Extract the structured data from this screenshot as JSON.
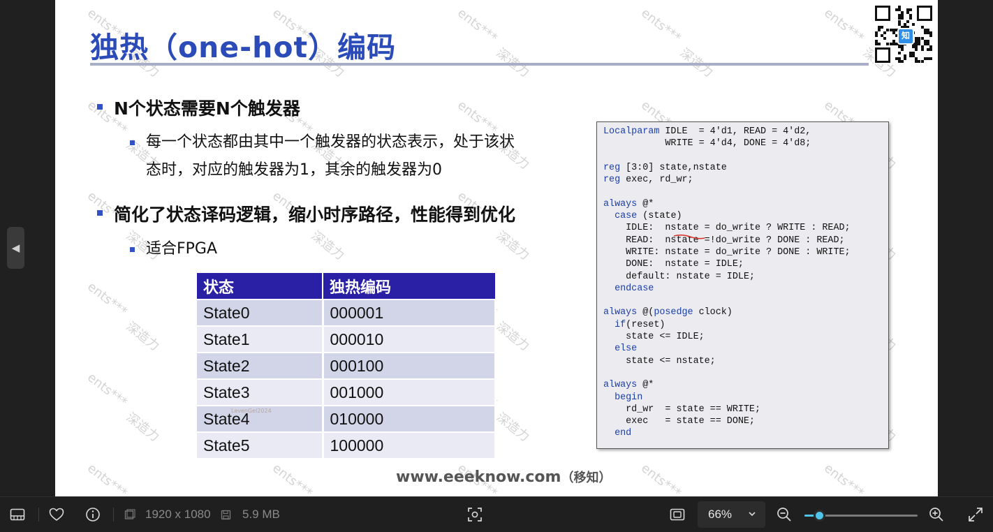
{
  "slide": {
    "title": "独热（one-hot）编码",
    "bullets": [
      {
        "level": 1,
        "text": "N个状态需要N个触发器"
      },
      {
        "level": 2,
        "lines": [
          "每一个状态都由其中一个触发器的状态表示，处于该状",
          "态时，对应的触发器为1，其余的触发器为0"
        ]
      },
      {
        "level": 1,
        "text": "简化了状态译码逻辑，缩小时序路径，性能得到优化"
      },
      {
        "level": 2,
        "lines": [
          "适合FPGA"
        ]
      }
    ],
    "table": {
      "headers": [
        "状态",
        "独热编码"
      ],
      "rows": [
        [
          "State0",
          "000001"
        ],
        [
          "State1",
          "000010"
        ],
        [
          "State2",
          "000100"
        ],
        [
          "State3",
          "001000"
        ],
        [
          "State4",
          "010000"
        ],
        [
          "State5",
          "100000"
        ]
      ]
    },
    "code_lines": [
      "Localparam IDLE  = 4'd1, READ = 4'd2,",
      "           WRITE = 4'd4, DONE = 4'd8;",
      "",
      "reg [3:0] state,nstate",
      "reg exec, rd_wr;",
      "",
      "always @*",
      "  case (state)",
      "    IDLE:  nstate = do_write ? WRITE : READ;",
      "    READ:  nstate =!do_write ? DONE : READ;",
      "    WRITE: nstate = do_write ? DONE : WRITE;",
      "    DONE:  nstate = IDLE;",
      "    default: nstate = IDLE;",
      "  endcase",
      "",
      "always @(posedge clock)",
      "  if(reset)",
      "    state <= IDLE;",
      "  else",
      "    state <= nstate;",
      "",
      "always @*",
      "  begin",
      "    rd_wr  = state == WRITE;",
      "    exec   = state == DONE;",
      "  end"
    ],
    "code_keywords": [
      "Localparam",
      "reg",
      "always",
      "case",
      "endcase",
      "if",
      "else",
      "begin",
      "end",
      "posedge"
    ],
    "footer_main": "www.eeeknow.com",
    "footer_sub": "（移知）",
    "watermark_a": "ents***",
    "watermark_b": "深造力",
    "tiny_watermark": "LevenGel2024",
    "qr_badge": "知"
  },
  "toolbar": {
    "dimensions": "1920 x 1080",
    "file_size": "5.9 MB",
    "zoom_label": "66%",
    "zoom_level_percent": 13
  },
  "icons": [
    "filmstrip-icon",
    "heart-icon",
    "info-icon",
    "image-icon",
    "save-icon",
    "scan-icon",
    "aspect-icon",
    "chevron-down-icon",
    "zoom-out-icon",
    "zoom-in-icon",
    "expand-icon",
    "prev-arrow-icon"
  ],
  "colors": {
    "title_blue": "#2a4bb8",
    "table_header": "#2a20a6",
    "keyword_blue": "#1c3ea8",
    "slider_accent": "#4fc3e8"
  }
}
